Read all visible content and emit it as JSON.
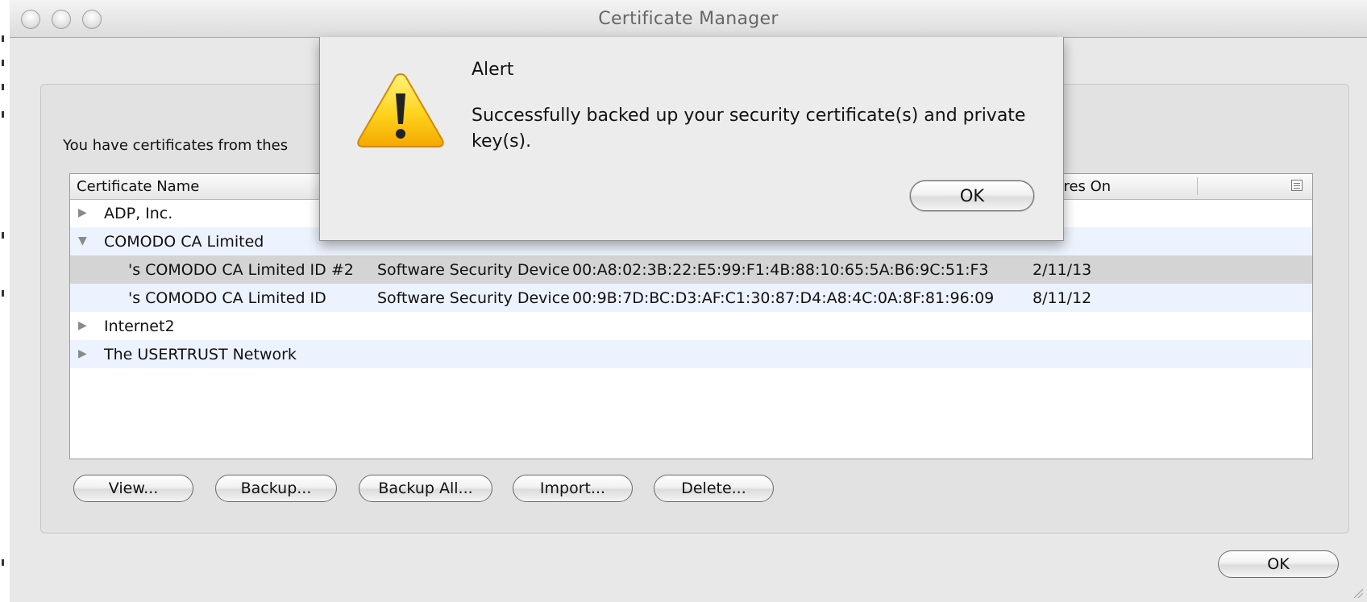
{
  "window": {
    "title": "Certificate Manager"
  },
  "intro_text": "You have certificates from thes",
  "table": {
    "columns": [
      {
        "label": "Certificate Name"
      },
      {
        "label": "Expires On"
      }
    ],
    "rows": [
      {
        "name": "ADP, Inc.",
        "device": "",
        "serial": "",
        "expires": "",
        "expanded": false,
        "child": false
      },
      {
        "name": "COMODO CA Limited",
        "device": "",
        "serial": "",
        "expires": "",
        "expanded": true,
        "child": false
      },
      {
        "name": "'s COMODO CA Limited ID #2",
        "device": "Software Security Device",
        "serial": "00:A8:02:3B:22:E5:99:F1:4B:88:10:65:5A:B6:9C:51:F3",
        "expires": "2/11/13",
        "child": true,
        "selected": true
      },
      {
        "name": "'s COMODO CA Limited ID",
        "device": "Software Security Device",
        "serial": "00:9B:7D:BC:D3:AF:C1:30:87:D4:A8:4C:0A:8F:81:96:09",
        "expires": "8/11/12",
        "child": true
      },
      {
        "name": "Internet2",
        "device": "",
        "serial": "",
        "expires": "",
        "expanded": false,
        "child": false
      },
      {
        "name": "The USERTRUST Network",
        "device": "",
        "serial": "",
        "expires": "",
        "expanded": false,
        "child": false
      }
    ]
  },
  "buttons": {
    "view": "View...",
    "backup": "Backup...",
    "backup_all": "Backup All...",
    "import": "Import...",
    "delete": "Delete...",
    "ok": "OK"
  },
  "alert": {
    "title": "Alert",
    "message": "Successfully backed up your security certificate(s) and private key(s).",
    "ok": "OK"
  }
}
